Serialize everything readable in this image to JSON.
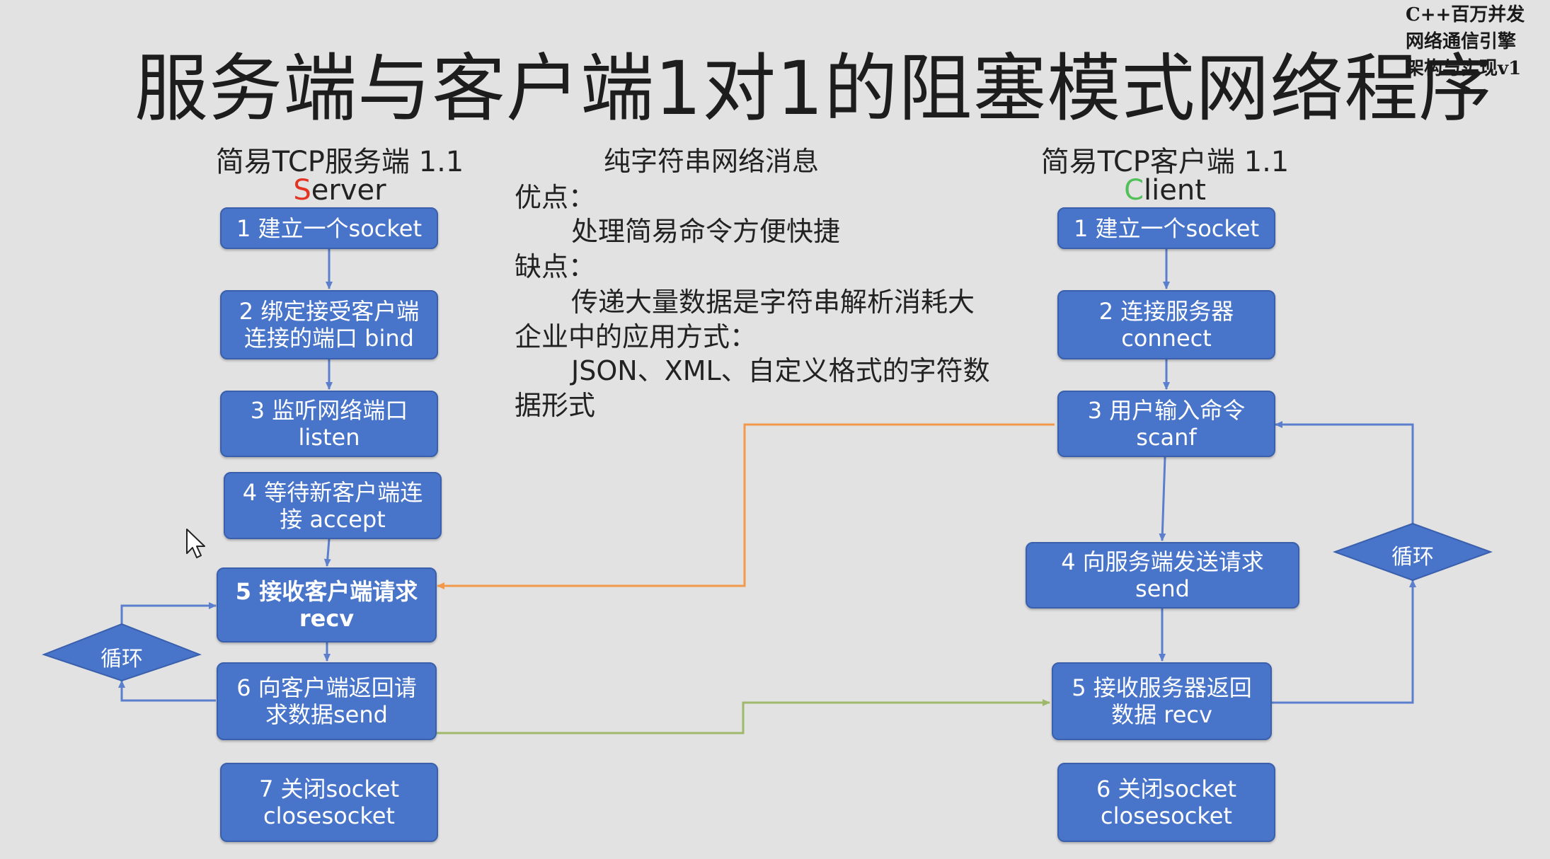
{
  "title": "服务端与客户端1对1的阻塞模式网络程序",
  "corner_text": [
    "C++百万并发",
    "网络通信引擎",
    "架构与实现v1"
  ],
  "server": {
    "title": "简易TCP服务端 1.1",
    "subtitle_first": "S",
    "subtitle_rest": "erver",
    "steps": [
      "1 建立一个socket",
      "2 绑定接受客户端\n连接的端口 bind",
      "3 监听网络端口\nlisten",
      "4 等待新客户端连\n接 accept",
      "5 接收客户端请求\nrecv",
      "6 向客户端返回请\n求数据send",
      "7 关闭socket\nclosesocket"
    ],
    "loop_label": "循环"
  },
  "client": {
    "title": "简易TCP客户端 1.1",
    "subtitle_first": "C",
    "subtitle_rest": "lient",
    "steps": [
      "1 建立一个socket",
      "2 连接服务器\nconnect",
      "3 用户输入命令\nscanf",
      "4 向服务端发送请求\nsend",
      "5 接收服务器返回\n数据 recv",
      "6 关闭socket\nclosesocket"
    ],
    "loop_label": "循环"
  },
  "middle": {
    "heading": "纯字符串网络消息",
    "lines": [
      "优点：",
      "处理简易命令方便快捷",
      "缺点：",
      "传递大量数据是字符串解析消耗大",
      "企业中的应用方式：",
      "JSON、XML、自定义格式的字符数",
      "据形式"
    ]
  },
  "colors": {
    "background": "#e2e2e2",
    "box_fill": "#4874c9",
    "box_border": "#3a60ad",
    "arrow_blue": "#5b7fcc",
    "arrow_orange": "#f29a4a",
    "arrow_green": "#9fb86a",
    "accent_red": "#e53322",
    "accent_green": "#52c058"
  }
}
